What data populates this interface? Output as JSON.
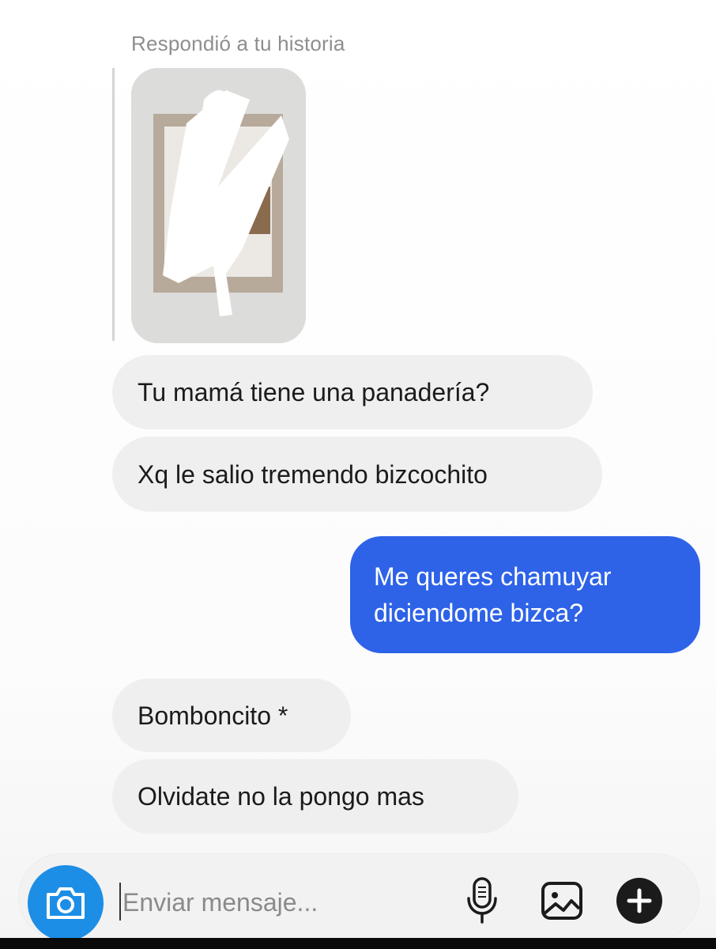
{
  "story_reply": {
    "caption": "Respondió a tu historia"
  },
  "messages": [
    {
      "direction": "received",
      "text": "Tu mamá tiene una panadería?"
    },
    {
      "direction": "received",
      "text": "Xq le salio tremendo bizcochito"
    },
    {
      "direction": "sent",
      "text": "Me queres chamuyar diciendome bizca?"
    },
    {
      "direction": "received",
      "text": "Bomboncito *"
    },
    {
      "direction": "received",
      "text": "Olvidate no la pongo mas"
    }
  ],
  "composer": {
    "placeholder": "Enviar mensaje...",
    "camera_icon": "camera-icon",
    "mic_icon": "microphone-icon",
    "gallery_icon": "image-gallery-icon",
    "plus_icon": "plus-circle-icon"
  },
  "colors": {
    "sent_bubble": "#2e63e8",
    "received_bubble": "#efefef",
    "camera_button": "#1d8ee6"
  }
}
